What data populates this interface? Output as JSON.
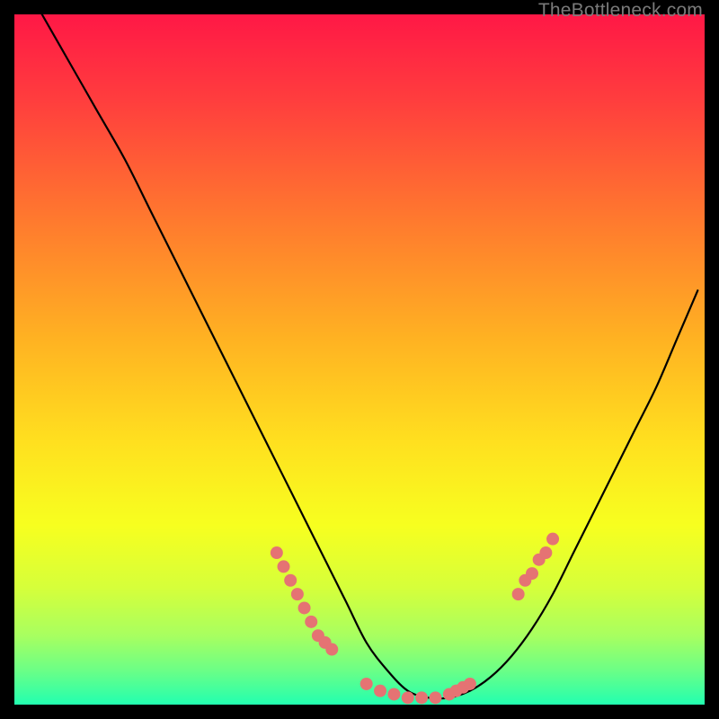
{
  "watermark": "TheBottleneck.com",
  "background": {
    "gradient_stops": [
      {
        "offset": 0.0,
        "color": "#ff1846"
      },
      {
        "offset": 0.12,
        "color": "#ff3c3e"
      },
      {
        "offset": 0.3,
        "color": "#ff7a2e"
      },
      {
        "offset": 0.47,
        "color": "#ffb222"
      },
      {
        "offset": 0.62,
        "color": "#ffe01f"
      },
      {
        "offset": 0.74,
        "color": "#f7ff1f"
      },
      {
        "offset": 0.83,
        "color": "#d6ff3a"
      },
      {
        "offset": 0.9,
        "color": "#a8ff60"
      },
      {
        "offset": 0.95,
        "color": "#6cff86"
      },
      {
        "offset": 1.0,
        "color": "#22ffb0"
      }
    ]
  },
  "chart_data": {
    "type": "line",
    "title": "",
    "xlabel": "",
    "ylabel": "",
    "xlim": [
      0,
      100
    ],
    "ylim": [
      0,
      100
    ],
    "series": [
      {
        "name": "bottleneck-curve",
        "x": [
          4,
          8,
          12,
          16,
          20,
          24,
          28,
          32,
          36,
          40,
          44,
          48,
          51,
          54,
          57,
          60,
          63,
          66,
          69,
          72,
          75,
          78,
          81,
          84,
          87,
          90,
          93,
          96,
          99
        ],
        "y": [
          100,
          93,
          86,
          79,
          71,
          63,
          55,
          47,
          39,
          31,
          23,
          15,
          9,
          5,
          2,
          1,
          1,
          2,
          4,
          7,
          11,
          16,
          22,
          28,
          34,
          40,
          46,
          53,
          60
        ]
      }
    ],
    "markers": [
      {
        "name": "left-cluster",
        "x": [
          38,
          39,
          40,
          41,
          42,
          43,
          44,
          45,
          46
        ],
        "y": [
          22,
          20,
          18,
          16,
          14,
          12,
          10,
          9,
          8
        ]
      },
      {
        "name": "bottom-cluster",
        "x": [
          51,
          53,
          55,
          57,
          59,
          61,
          63,
          64,
          65,
          66
        ],
        "y": [
          3,
          2,
          1.5,
          1,
          1,
          1,
          1.5,
          2,
          2.5,
          3
        ]
      },
      {
        "name": "right-cluster",
        "x": [
          73,
          74,
          75,
          76,
          77,
          78
        ],
        "y": [
          16,
          18,
          19,
          21,
          22,
          24
        ]
      }
    ],
    "marker_style": {
      "color": "#e57373",
      "radius": 7
    }
  }
}
